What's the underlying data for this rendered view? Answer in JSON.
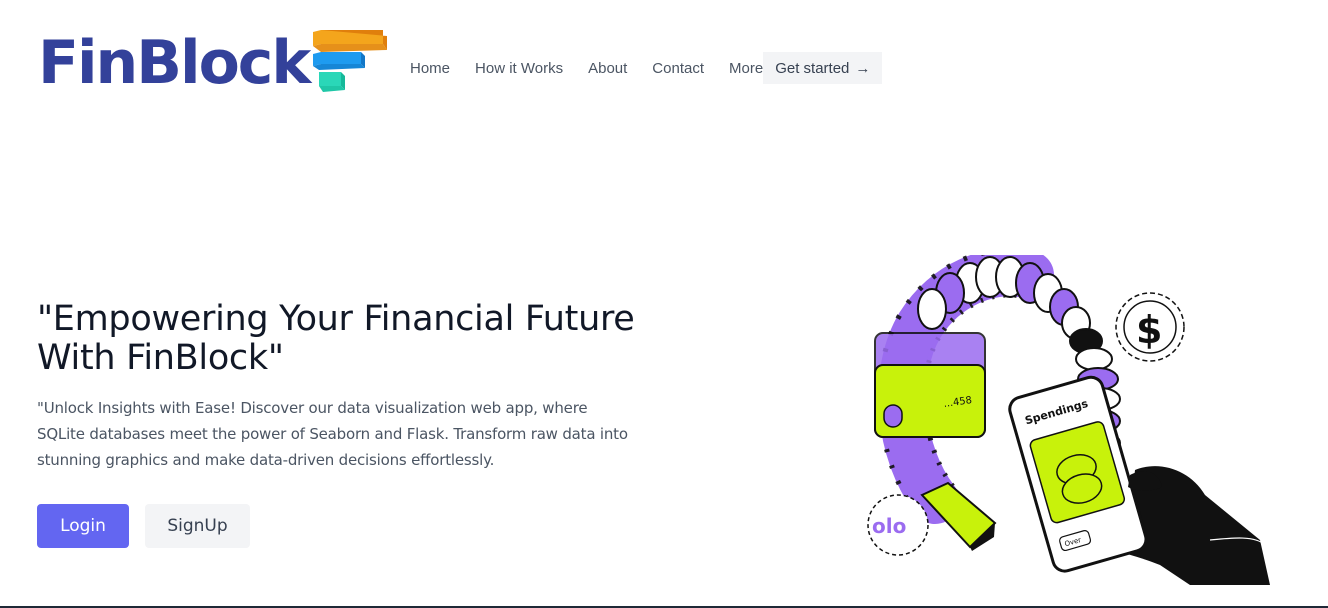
{
  "brand": {
    "name": "FinBlock",
    "logo_colors": [
      "#f4a51c",
      "#1e9bf0",
      "#2ad7b8"
    ],
    "text_color": "#33419a"
  },
  "nav": {
    "items": [
      {
        "label": "Home"
      },
      {
        "label": "How it Works"
      },
      {
        "label": "About"
      },
      {
        "label": "Contact"
      },
      {
        "label": "More"
      }
    ],
    "cta": {
      "label": "Get started",
      "icon": "arrow-right-icon"
    }
  },
  "hero": {
    "title": "\"Empowering Your Financial Future With FinBlock\"",
    "description": "\"Unlock Insights with Ease! Discover our data visualization web app, where SQLite databases meet the power of Seaborn and Flask. Transform raw data into stunning graphics and make data-driven decisions effortlessly.",
    "login_label": "Login",
    "signup_label": "SignUp",
    "accent_color": "#6366f1"
  },
  "illustration": {
    "phone_title": "Spendings",
    "card_number": "...458",
    "phone_button": "Over",
    "coin_symbol": "$",
    "lime": "#c8f20b",
    "purple": "#9b6cf0"
  }
}
